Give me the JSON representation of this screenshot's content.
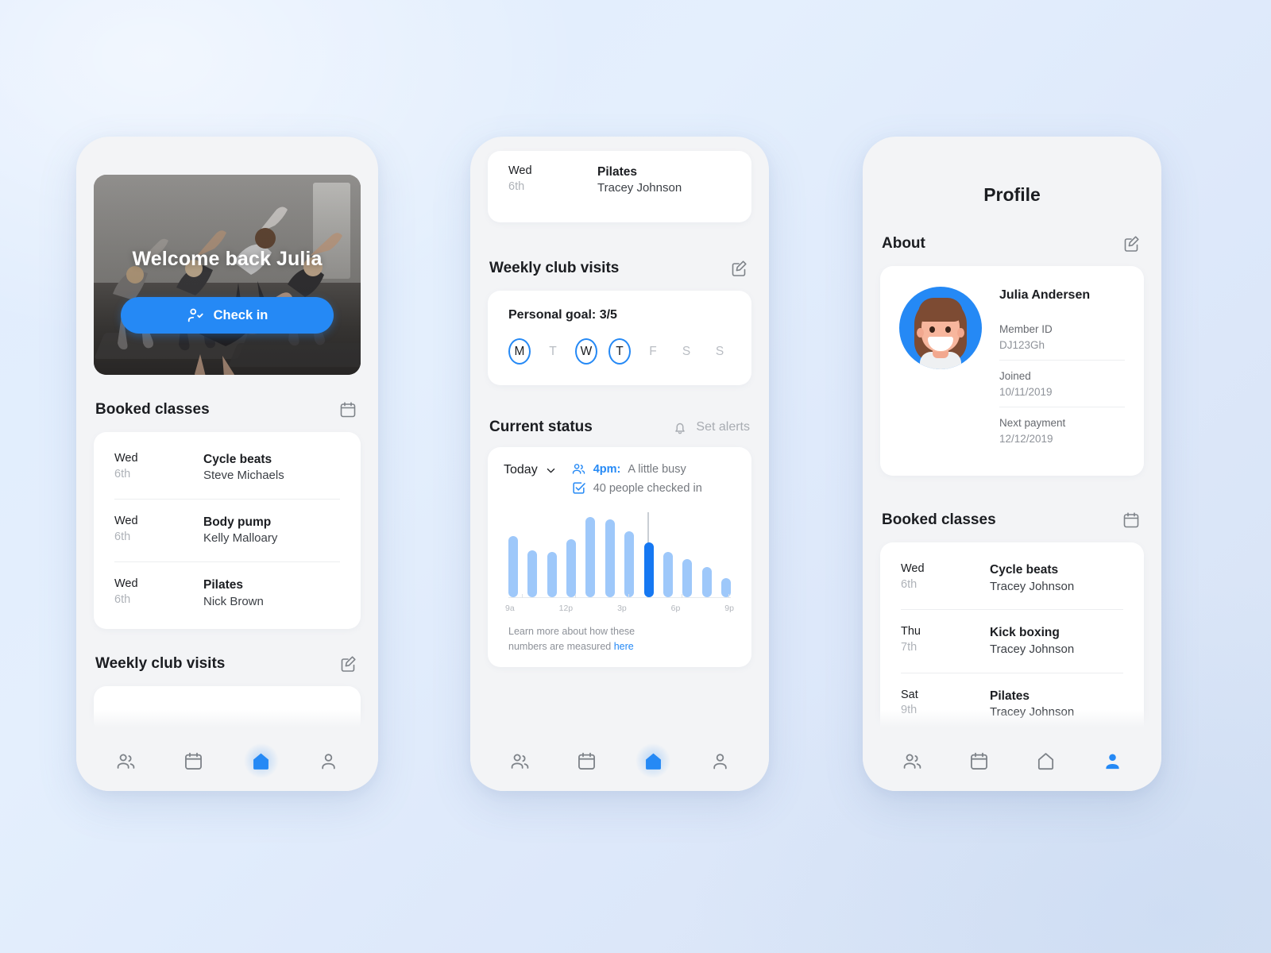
{
  "app": {
    "accent": "#2589f5",
    "accent_dark": "#1678f2",
    "bar_color": "#9ec8fa",
    "page_bg_from": "#e0ecfd",
    "page_bg_to": "#d6e2f4"
  },
  "home": {
    "hero": {
      "title": "Welcome back Julia",
      "checkin_label": "Check in",
      "checkin_icon": "user-check-icon"
    },
    "booked": {
      "heading": "Booked classes",
      "icon": "calendar-icon",
      "classes": [
        {
          "day": "Wed",
          "date": "6th",
          "name": "Cycle beats",
          "instructor": "Steve Michaels"
        },
        {
          "day": "Wed",
          "date": "6th",
          "name": "Body pump",
          "instructor": "Kelly Malloary"
        },
        {
          "day": "Wed",
          "date": "6th",
          "name": "Pilates",
          "instructor": "Nick Brown"
        }
      ]
    },
    "weekly": {
      "heading": "Weekly club visits",
      "icon": "edit-icon"
    },
    "tabs": [
      {
        "name": "tab-community",
        "icon": "people-icon",
        "active": false
      },
      {
        "name": "tab-calendar",
        "icon": "calendar-icon",
        "active": false
      },
      {
        "name": "tab-home",
        "icon": "home-icon",
        "active": true
      },
      {
        "name": "tab-profile",
        "icon": "person-icon",
        "active": false
      }
    ]
  },
  "status_screen": {
    "partial_class": {
      "day": "Wed",
      "date": "6th",
      "name": "Pilates",
      "instructor": "Tracey Johnson"
    },
    "weekly": {
      "heading": "Weekly club visits",
      "icon": "edit-icon",
      "goal_text": "Personal goal: 3/5",
      "days": [
        {
          "letter": "M",
          "done": true
        },
        {
          "letter": "T",
          "done": false
        },
        {
          "letter": "W",
          "done": true
        },
        {
          "letter": "T",
          "done": true
        },
        {
          "letter": "F",
          "done": false
        },
        {
          "letter": "S",
          "done": false
        },
        {
          "letter": "S",
          "done": false
        }
      ]
    },
    "current_status": {
      "heading": "Current status",
      "alerts_label": "Set alerts",
      "alerts_icon": "bell-icon",
      "day_selector": "Today",
      "day_selector_icon": "chevron-down-icon",
      "busy_time": "4pm:",
      "busy_label": "A little busy",
      "busy_icon": "people-icon",
      "checked_in": "40 people checked in",
      "checked_icon": "checkbox-icon",
      "learn_more_text": "Learn more about how these numbers are measured",
      "learn_more_link": "here"
    },
    "tabs": [
      {
        "name": "tab-community",
        "icon": "people-icon",
        "active": false
      },
      {
        "name": "tab-calendar",
        "icon": "calendar-icon",
        "active": false
      },
      {
        "name": "tab-home",
        "icon": "home-icon",
        "active": true
      },
      {
        "name": "tab-profile",
        "icon": "person-icon",
        "active": false
      }
    ]
  },
  "profile_screen": {
    "title": "Profile",
    "about": {
      "heading": "About",
      "icon": "edit-icon",
      "name": "Julia Andersen",
      "fields": [
        {
          "label": "Member ID",
          "value": "DJ123Gh"
        },
        {
          "label": "Joined",
          "value": "10/11/2019"
        },
        {
          "label": "Next payment",
          "value": "12/12/2019"
        }
      ]
    },
    "booked": {
      "heading": "Booked classes",
      "icon": "calendar-icon",
      "classes": [
        {
          "day": "Wed",
          "date": "6th",
          "name": "Cycle beats",
          "instructor": "Tracey Johnson"
        },
        {
          "day": "Thu",
          "date": "7th",
          "name": "Kick boxing",
          "instructor": "Tracey Johnson"
        },
        {
          "day": "Sat",
          "date": "9th",
          "name": "Pilates",
          "instructor": "Tracey Johnson"
        }
      ]
    },
    "tabs": [
      {
        "name": "tab-community",
        "icon": "people-icon",
        "active": false
      },
      {
        "name": "tab-calendar",
        "icon": "calendar-icon",
        "active": false
      },
      {
        "name": "tab-home",
        "icon": "home-icon",
        "active": false
      },
      {
        "name": "tab-profile",
        "icon": "person-icon",
        "active": true
      }
    ]
  },
  "chart_data": {
    "type": "bar",
    "title": "Current status",
    "xlabel": "",
    "ylabel": "",
    "categories": [
      "9a",
      "10a",
      "11a",
      "12p",
      "1p",
      "2p",
      "3p",
      "4p",
      "5p",
      "6p",
      "7p",
      "8p"
    ],
    "tick_labels": [
      "9a",
      "12p",
      "3p",
      "6p",
      "9p"
    ],
    "values": [
      55,
      42,
      41,
      52,
      72,
      70,
      59,
      49,
      41,
      34,
      27,
      17
    ],
    "highlight_index": 7,
    "highlight_label": "4pm",
    "ylim": [
      0,
      80
    ],
    "grid": false,
    "legend": "none",
    "bar_color": "#9ec8fa",
    "highlight_color": "#1678f2",
    "annotation": "40 people checked in"
  }
}
